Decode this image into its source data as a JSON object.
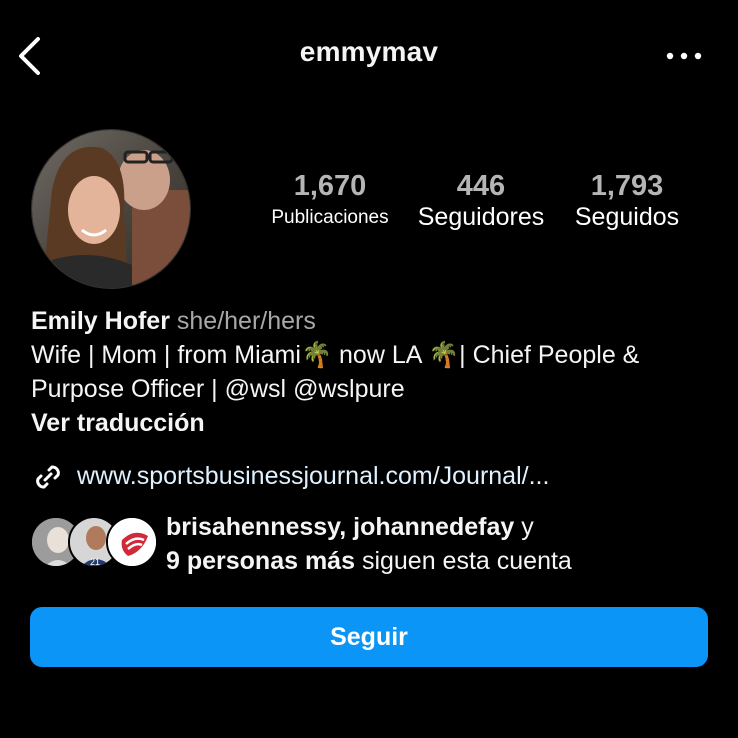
{
  "header": {
    "username": "emmymav",
    "back_icon": "chevron-left-icon",
    "more_icon": "more-horizontal-icon"
  },
  "stats": {
    "posts_count": "1,670",
    "posts_label": "Publicaciones",
    "followers_count": "446",
    "followers_label": "Seguidores",
    "following_count": "1,793",
    "following_label": "Seguidos"
  },
  "bio": {
    "name": "Emily Hofer",
    "pronouns": "she/her/hers",
    "line1_a": "Wife | Mom | from Miami",
    "palm": "🌴",
    "line1_b": " now LA ",
    "line1_c": "| Chief People &",
    "line2_a": "Purpose Officer | ",
    "mention1": "@wsl",
    "mention2": "@wslpure",
    "translate": "Ver traducción"
  },
  "link": {
    "icon": "link-icon",
    "text": "www.sportsbusinessjournal.com/Journal/..."
  },
  "followed_by": {
    "users": "brisahennessy, johannedefay",
    "conj": " y",
    "more": "9 personas más",
    "suffix": " siguen esta cuenta"
  },
  "follow_button": {
    "label": "Seguir"
  },
  "colors": {
    "background": "#000000",
    "button": "#0b95f6",
    "muted": "#a8a8a8",
    "link": "#e0f1ff"
  }
}
